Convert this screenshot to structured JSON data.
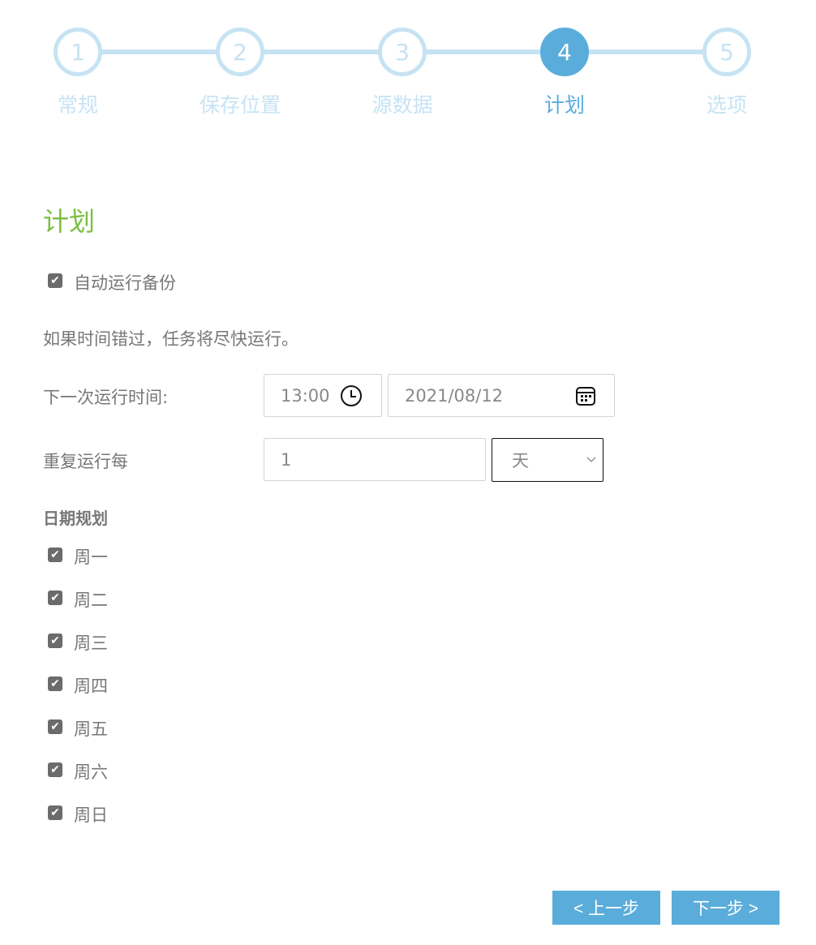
{
  "stepper": {
    "steps": [
      {
        "number": "1",
        "label": "常规",
        "active": false
      },
      {
        "number": "2",
        "label": "保存位置",
        "active": false
      },
      {
        "number": "3",
        "label": "源数据",
        "active": false
      },
      {
        "number": "4",
        "label": "计划",
        "active": true
      },
      {
        "number": "5",
        "label": "选项",
        "active": false
      }
    ],
    "active_color": "#5aaddb",
    "inactive_color": "#c6e3f4"
  },
  "page": {
    "title": "计划",
    "title_color": "#7cbf3f"
  },
  "auto_run": {
    "label": "自动运行备份",
    "checked": true
  },
  "notice": "如果时间错过，任务将尽快运行。",
  "next_run": {
    "label": "下一次运行时间:",
    "time": "13:00",
    "date": "2021/08/12",
    "time_icon": "clock-icon",
    "date_icon": "calendar-icon"
  },
  "repeat": {
    "label": "重复运行每",
    "value": "1",
    "unit": "天"
  },
  "schedule": {
    "heading": "日期规划",
    "days": [
      {
        "label": "周一",
        "checked": true
      },
      {
        "label": "周二",
        "checked": true
      },
      {
        "label": "周三",
        "checked": true
      },
      {
        "label": "周四",
        "checked": true
      },
      {
        "label": "周五",
        "checked": true
      },
      {
        "label": "周六",
        "checked": true
      },
      {
        "label": "周日",
        "checked": true
      }
    ]
  },
  "buttons": {
    "prev": "< 上一步",
    "next": "下一步 >"
  }
}
